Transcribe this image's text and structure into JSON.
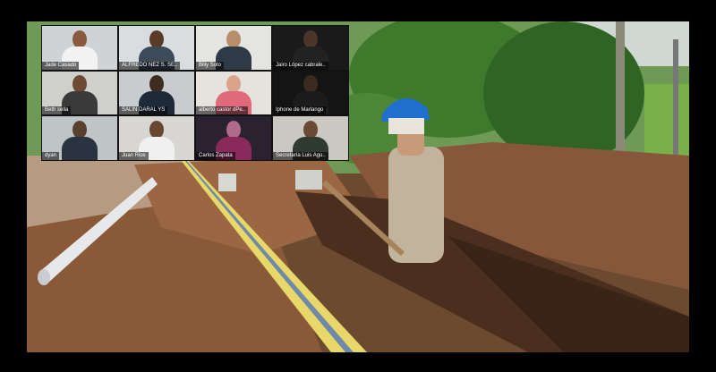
{
  "meeting": {
    "participants": [
      {
        "name": "Jade Casado"
      },
      {
        "name": "ALFREDO NEZ S. SE.."
      },
      {
        "name": "Billy Soto"
      },
      {
        "name": "Jairo López cabrale.."
      },
      {
        "name": "Beth sella"
      },
      {
        "name": "SALIN DARAL YS"
      },
      {
        "name": "alberto castor dPe.."
      },
      {
        "name": "Iphone de Marlango"
      },
      {
        "name": "dyan"
      },
      {
        "name": "Juan Rios"
      },
      {
        "name": "Carlos Zapata"
      },
      {
        "name": "Secretaría Luis Agu.."
      }
    ],
    "active_index": 1
  },
  "colors": {
    "active_border": "#6fc24a",
    "soil": "#8a5a38",
    "hard_hat": "#1f6fd1",
    "pipe": "#e6e8ea",
    "tape": "#e8d86a"
  }
}
